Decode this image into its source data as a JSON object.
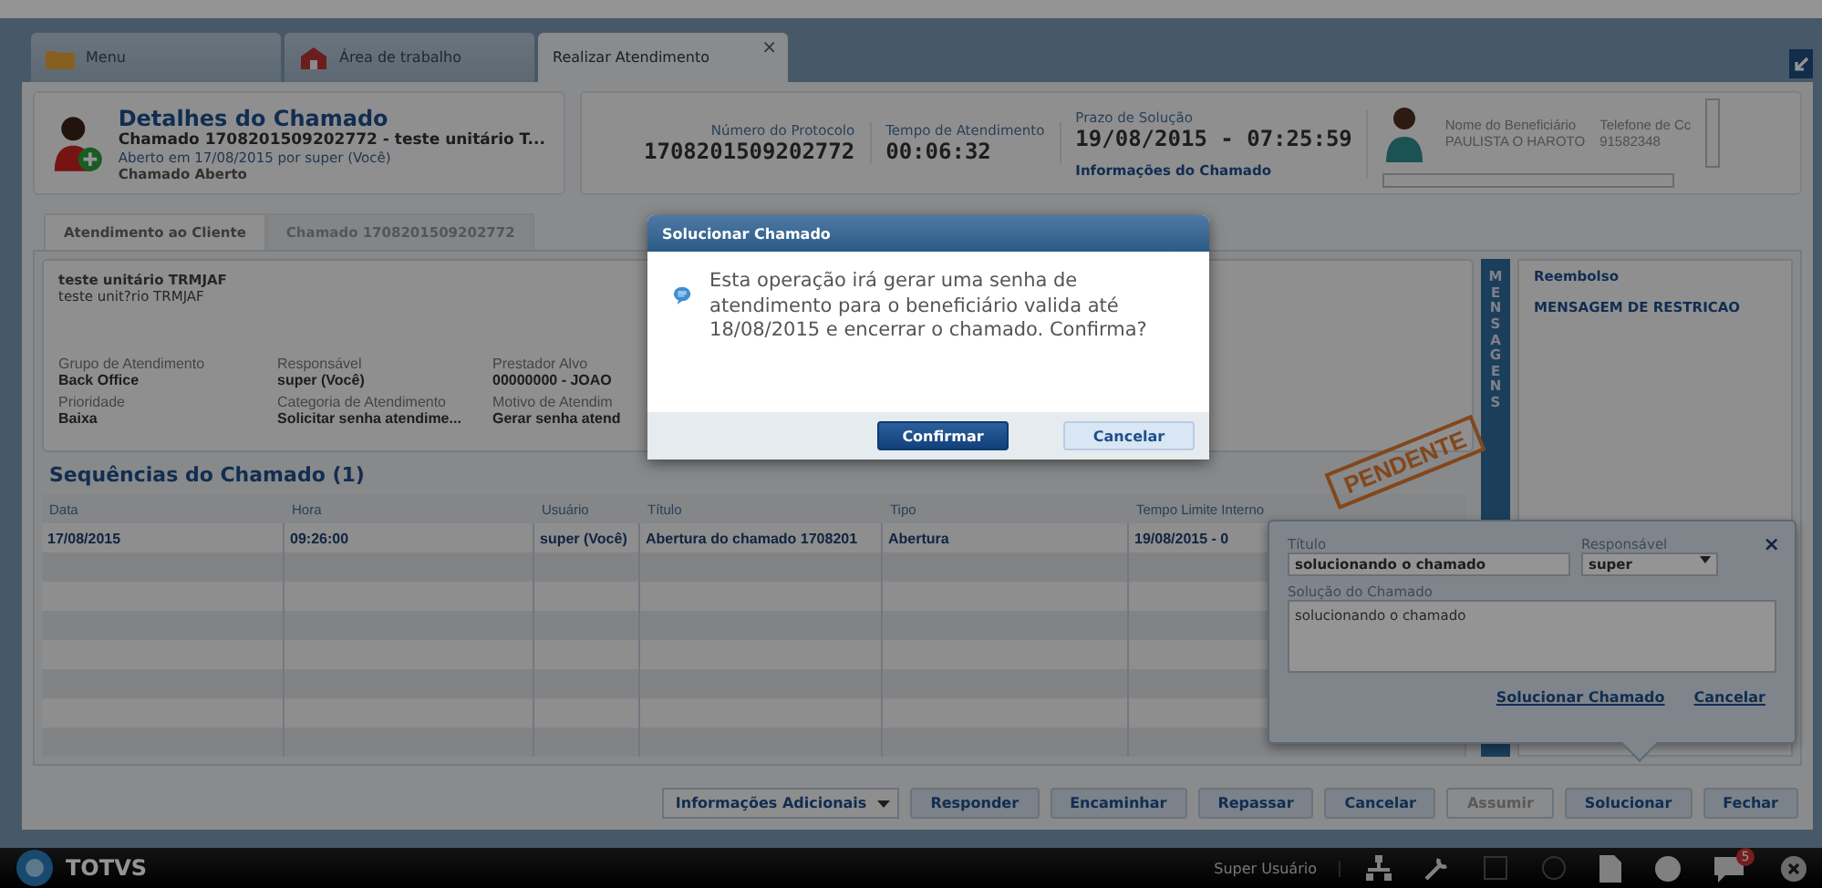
{
  "tabs": [
    {
      "label": "Menu",
      "kind": "folder",
      "selected": false
    },
    {
      "label": "Área de trabalho",
      "kind": "house",
      "selected": false
    },
    {
      "label": "Realizar Atendimento",
      "kind": "plain",
      "selected": true,
      "close": "×"
    }
  ],
  "ticket": {
    "title": "Detalhes do Chamado",
    "subtitle": "Chamado 1708201509202772 - teste unitário T...",
    "opened": "Aberto em 17/08/2015 por super (Você)",
    "status": "Chamado Aberto"
  },
  "summary": [
    {
      "label": "Número do Protocolo",
      "value": "1708201509202772"
    },
    {
      "label": "Tempo de Atendimento",
      "value": "00:06:32"
    },
    {
      "label": "Prazo de Solução",
      "value": "19/08/2015 - 07:25:59",
      "link": "Informações do Chamado"
    }
  ],
  "beneficiary": [
    {
      "label": "Nome do Beneficiário",
      "value": "PAULISTA O HAROTO"
    },
    {
      "label": "Telefone de Cc",
      "value": "91582348"
    }
  ],
  "inner_tabs": [
    {
      "label": "Atendimento ao Cliente",
      "selected": true
    },
    {
      "label": "Chamado 1708201509202772",
      "selected": false
    }
  ],
  "details": {
    "lines": [
      "teste unitário TRMJAF",
      "teste unit?rio TRMJAF"
    ],
    "fields": [
      {
        "label": "Grupo de Atendimento",
        "value": "Back Office"
      },
      {
        "label": "Responsável",
        "value": "super (Você)"
      },
      {
        "label": "Prestador Alvo",
        "value": "00000000 - JOAO"
      },
      {
        "label": "Prioridade",
        "value": "Baixa"
      },
      {
        "label": "Categoria de Atendimento",
        "value": "Solicitar senha atendime..."
      },
      {
        "label": "Motivo de Atendim",
        "value": "Gerar senha atend"
      }
    ]
  },
  "messages": {
    "tab": "MENSAGENS",
    "items": [
      "Reembolso",
      "MENSAGEM DE RESTRICAO"
    ]
  },
  "sequences": {
    "title": "Sequências do Chamado (1)",
    "columns": [
      "Data",
      "Hora",
      "Usuário",
      "Título",
      "Tipo",
      "Tempo Limite Interno"
    ],
    "rows": [
      [
        "17/08/2015",
        "09:26:00",
        "super (Você)",
        "Abertura do chamado 1708201",
        "Abertura",
        "19/08/2015 - 0"
      ]
    ]
  },
  "stamp": "PENDENTE",
  "popover": {
    "title_label": "Título",
    "title_value": "solucionando o chamado",
    "owner_label": "Responsável",
    "owner_value": "super",
    "solution_label": "Solução do Chamado",
    "solution_value": "solucionando o chamado",
    "close": "×",
    "actions": [
      "Solucionar Chamado",
      "Cancelar"
    ]
  },
  "buttons": [
    {
      "label": "Informações Adicionais",
      "kind": "dropdown",
      "disabled": false
    },
    {
      "label": "Responder",
      "kind": "plain",
      "disabled": false
    },
    {
      "label": "Encaminhar",
      "kind": "plain",
      "disabled": false
    },
    {
      "label": "Repassar",
      "kind": "plain",
      "disabled": false
    },
    {
      "label": "Cancelar",
      "kind": "plain",
      "disabled": false
    },
    {
      "label": "Assumir",
      "kind": "plain",
      "disabled": true
    },
    {
      "label": "Solucionar",
      "kind": "plain",
      "disabled": false
    },
    {
      "label": "Fechar",
      "kind": "plain",
      "disabled": false
    }
  ],
  "taskbar": {
    "brand": "TOTVS",
    "user": "Super Usuário",
    "badge": "5"
  },
  "dialog": {
    "title": "Solucionar Chamado",
    "message": "Esta operação irá gerar uma senha de atendimento para o beneficiário valida até 18/08/2015 e encerrar o chamado. Confirma?",
    "buttons": [
      {
        "label": "Confirmar",
        "primary": true
      },
      {
        "label": "Cancelar",
        "primary": false
      }
    ]
  }
}
